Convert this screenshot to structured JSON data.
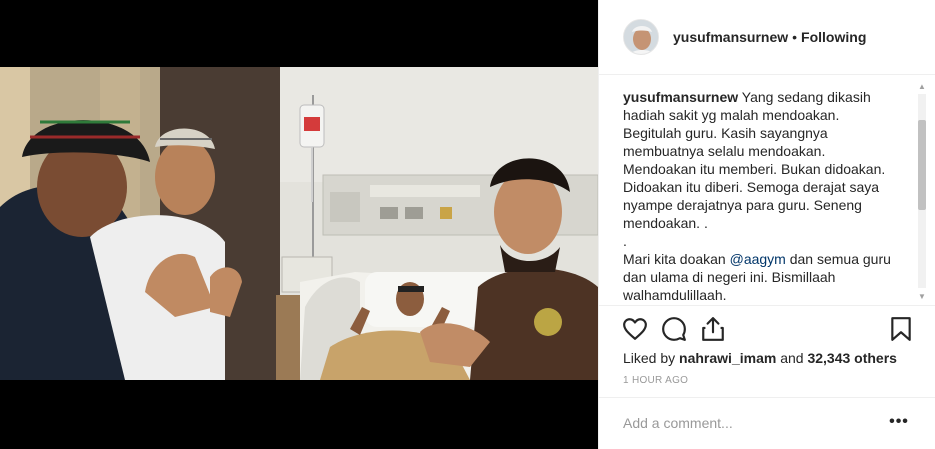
{
  "post": {
    "username": "yusufmansurnew",
    "separator": "•",
    "follow_status": "Following",
    "avatar": "profile-avatar",
    "caption_lines": [
      {
        "user": "yusufmansurnew",
        "text": " Yang sedang dikasih"
      },
      {
        "text": "hadiah sakit yg malah mendoakan."
      },
      {
        "text": "Begitulah guru. Kasih sayangnya"
      },
      {
        "text": "membuatnya selalu mendoakan."
      },
      {
        "text": "Mendoakan itu memberi. Bukan didoakan."
      },
      {
        "text": "Didoakan itu diberi. Semoga derajat saya"
      },
      {
        "text": "nyampe derajatnya para guru. Seneng"
      },
      {
        "text": "mendoakan. ."
      },
      {
        "text": "."
      },
      {
        "pre": "Mari kita doakan ",
        "mention": "@aagym",
        "post": " dan semua guru"
      },
      {
        "text": "dan ulama di negeri ini. Bismillaah"
      },
      {
        "text": "walhamdulillaah."
      }
    ],
    "likes": {
      "liked_by_prefix": "Liked by ",
      "liked_user": "nahrawi_imam",
      "and_text": " and ",
      "count": "32,343 others"
    },
    "time": "1 HOUR AGO",
    "comment": {
      "placeholder": "Add a comment..."
    },
    "more_label": "•••"
  },
  "icons": [
    "heart-icon",
    "comment-icon",
    "share-icon",
    "bookmark-icon"
  ],
  "colors": {
    "link": "#003569",
    "border": "#efefef",
    "muted": "#999999",
    "text": "#262626"
  }
}
